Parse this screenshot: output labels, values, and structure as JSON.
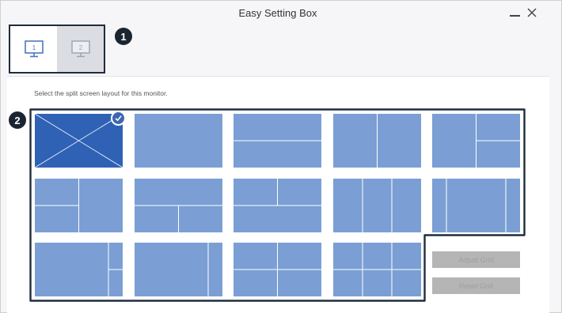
{
  "window": {
    "title": "Easy Setting Box",
    "minimize_icon": "minimize-icon",
    "close_icon": "close-icon"
  },
  "monitors": [
    {
      "label": "1",
      "selected": true,
      "icon": "monitor-icon"
    },
    {
      "label": "2",
      "selected": false,
      "icon": "monitor-icon"
    }
  ],
  "badges": {
    "first": "1",
    "second": "2"
  },
  "instruction": "Select the split screen layout for this monitor.",
  "layouts": [
    {
      "name": "layout-1-full-selected",
      "selected": true
    },
    {
      "name": "layout-2-full"
    },
    {
      "name": "layout-3-horizontal-split"
    },
    {
      "name": "layout-4-vertical-split"
    },
    {
      "name": "layout-5-left-plus-two-right"
    },
    {
      "name": "layout-6-two-left-plus-right"
    },
    {
      "name": "layout-7-top-plus-two-bottom"
    },
    {
      "name": "layout-8-two-top-plus-bottom"
    },
    {
      "name": "layout-9-three-columns"
    },
    {
      "name": "layout-10-wide-center-columns"
    },
    {
      "name": "layout-11-large-left-plus-two-right"
    },
    {
      "name": "layout-12-large-left-plus-narrow-right"
    },
    {
      "name": "layout-13-four-quadrants"
    },
    {
      "name": "layout-14-six-grid"
    }
  ],
  "buttons": {
    "adjust": "Adjust Grid",
    "reset": "Reset Grid"
  },
  "colors": {
    "tile_fill": "#7b9fd4",
    "tile_selected": "#2f62b5",
    "tile_line": "#ffffff",
    "frame": "#1f2d3d",
    "disabled_button": "#b5b5b5"
  }
}
